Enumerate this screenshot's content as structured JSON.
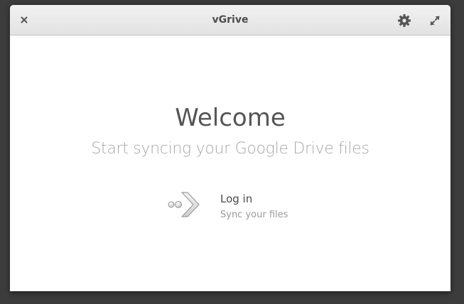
{
  "window": {
    "title": "vGrive"
  },
  "main": {
    "welcome": "Welcome",
    "subtitle": "Start syncing your Google Drive files",
    "login": {
      "label": "Log in",
      "description": "Sync your files",
      "icon": "login-arrow-icon"
    }
  },
  "icons": {
    "close": "close-icon",
    "settings": "gear-icon",
    "maximize": "maximize-icon"
  },
  "colors": {
    "title_text": "#4d4d4d",
    "heading": "#555555",
    "subtitle": "#a8a8a8"
  }
}
